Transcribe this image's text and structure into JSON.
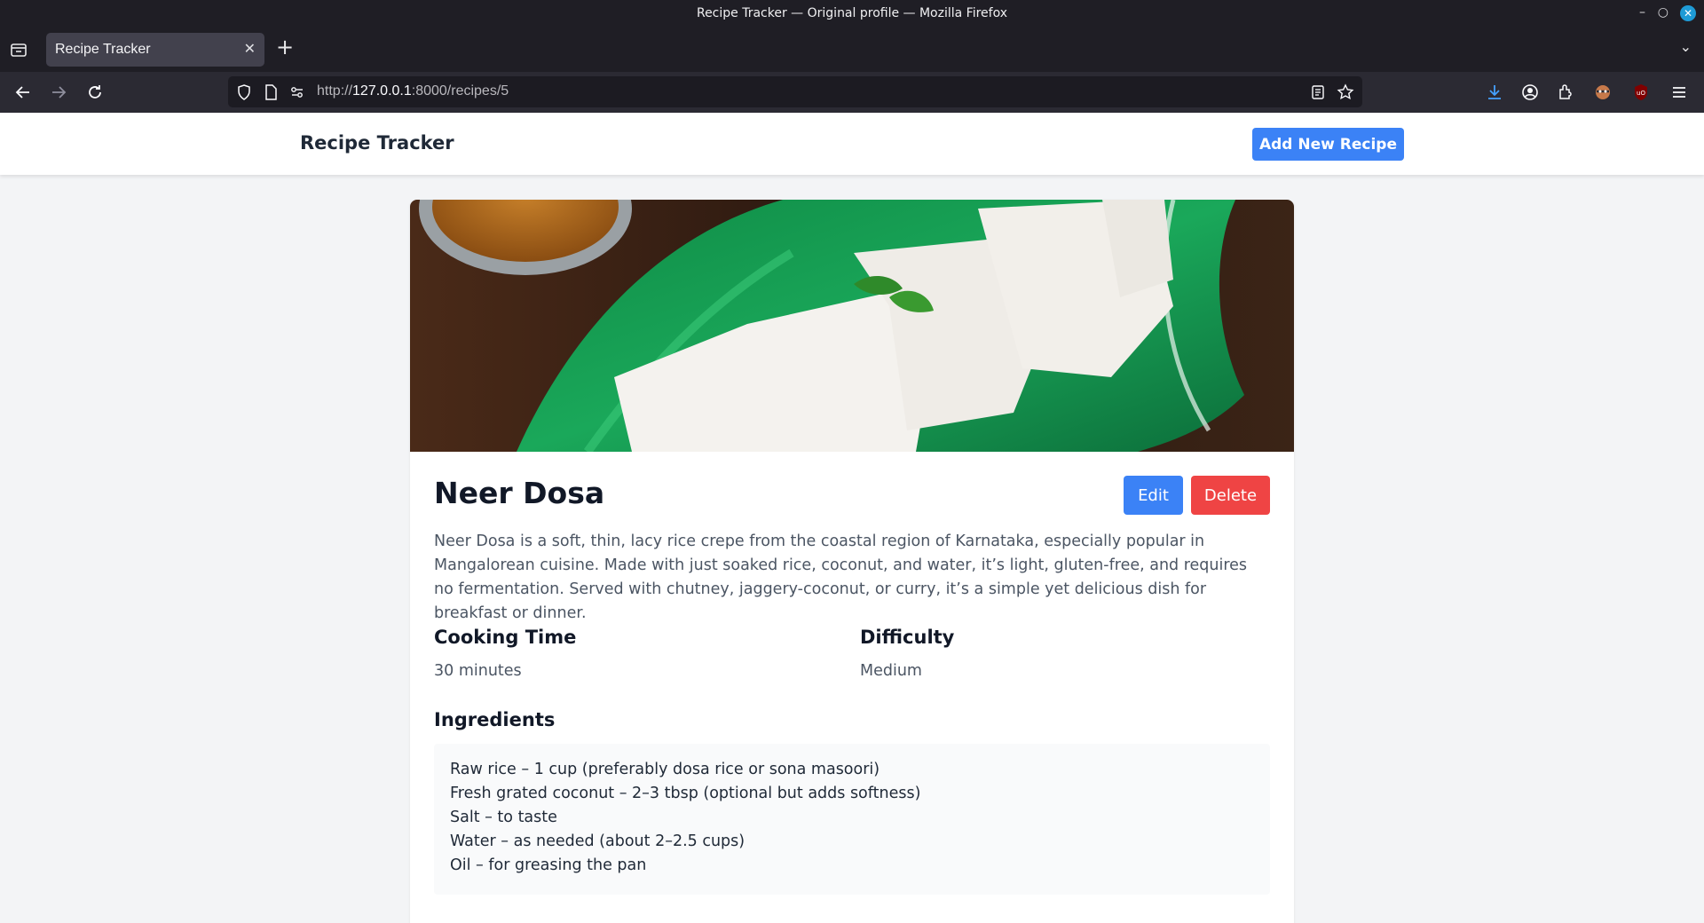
{
  "browser": {
    "window_title": "Recipe Tracker — Original profile — Mozilla Firefox",
    "tab_title": "Recipe Tracker",
    "url_scheme": "http://",
    "url_host": "127.0.0.1",
    "url_rest": ":8000/recipes/5"
  },
  "header": {
    "brand": "Recipe Tracker",
    "add_button": "Add New Recipe"
  },
  "recipe": {
    "title": "Neer Dosa",
    "edit_label": "Edit",
    "delete_label": "Delete",
    "description": "Neer Dosa is a soft, thin, lacy rice crepe from the coastal region of Karnataka, especially popular in Mangalorean cuisine. Made with just soaked rice, coconut, and water, it’s light, gluten-free, and requires no fermentation. Served with chutney, jaggery-coconut, or curry, it’s a simple yet delicious dish for breakfast or dinner.",
    "cooking_time_label": "Cooking Time",
    "cooking_time": "30 minutes",
    "difficulty_label": "Difficulty",
    "difficulty": "Medium",
    "ingredients_label": "Ingredients",
    "ingredients": [
      "Raw rice – 1 cup (preferably dosa rice or sona masoori)",
      "Fresh grated coconut – 2–3 tbsp (optional but adds softness)",
      "Salt – to taste",
      "Water – as needed (about 2–2.5 cups)",
      "Oil – for greasing the pan"
    ]
  },
  "colors": {
    "primary": "#3b82f6",
    "danger": "#ef4444",
    "page_bg": "#f3f4f6"
  }
}
